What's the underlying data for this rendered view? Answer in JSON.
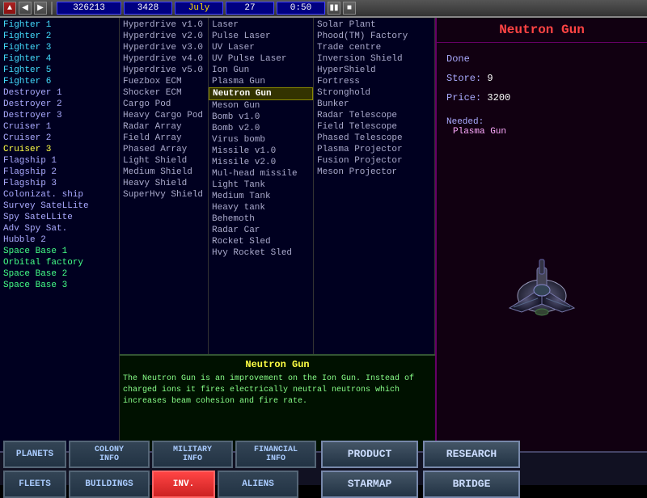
{
  "toolbar": {
    "credits": "326213",
    "production": "3428",
    "month": "July",
    "day": "27",
    "time": "0:50"
  },
  "left_list": {
    "items": [
      {
        "label": "Fighter 1",
        "style": "cyan"
      },
      {
        "label": "Fighter 2",
        "style": "cyan"
      },
      {
        "label": "Fighter 3",
        "style": "cyan"
      },
      {
        "label": "Fighter 4",
        "style": "cyan"
      },
      {
        "label": "Fighter 5",
        "style": "cyan"
      },
      {
        "label": "Fighter 6",
        "style": "cyan"
      },
      {
        "label": "Destroyer 1",
        "style": "normal"
      },
      {
        "label": "Destroyer 2",
        "style": "normal"
      },
      {
        "label": "Destroyer 3",
        "style": "normal"
      },
      {
        "label": "Cruiser 1",
        "style": "normal"
      },
      {
        "label": "Cruiser 2",
        "style": "normal"
      },
      {
        "label": "Cruiser 3",
        "style": "yellow"
      },
      {
        "label": "Flagship 1",
        "style": "normal"
      },
      {
        "label": "Flagship 2",
        "style": "normal"
      },
      {
        "label": "Flagship 3",
        "style": "normal"
      },
      {
        "label": "Colonizat. ship",
        "style": "normal"
      },
      {
        "label": "Survey SateLLite",
        "style": "normal"
      },
      {
        "label": "Spy SateLLite",
        "style": "normal"
      },
      {
        "label": "Adv Spy Sat.",
        "style": "normal"
      },
      {
        "label": "Hubble 2",
        "style": "normal"
      },
      {
        "label": "Space Base 1",
        "style": "green-text"
      },
      {
        "label": "Orbital factory",
        "style": "green-text"
      },
      {
        "label": "Space Base 2",
        "style": "green-text"
      },
      {
        "label": "Space Base 3",
        "style": "green-text"
      }
    ]
  },
  "ecm_list": {
    "items": [
      {
        "label": "Hyperdrive v1.0"
      },
      {
        "label": "Hyperdrive v2.0"
      },
      {
        "label": "Hyperdrive v3.0"
      },
      {
        "label": "Hyperdrive v4.0"
      },
      {
        "label": "Hyperdrive v5.0"
      },
      {
        "label": "Fuezbox ECM"
      },
      {
        "label": "Shocker ECM"
      },
      {
        "label": "Cargo Pod"
      },
      {
        "label": "Heavy Cargo Pod"
      },
      {
        "label": "Radar Array"
      },
      {
        "label": "Field Array"
      },
      {
        "label": "Phased Array"
      },
      {
        "label": "Light Shield"
      },
      {
        "label": "Medium Shield"
      },
      {
        "label": "Heavy Shield"
      },
      {
        "label": "SuperHvy Shield"
      }
    ]
  },
  "weapon_list": {
    "items": [
      {
        "label": "Laser"
      },
      {
        "label": "Pulse Laser"
      },
      {
        "label": "UV Laser"
      },
      {
        "label": "UV Pulse Laser"
      },
      {
        "label": "Ion Gun"
      },
      {
        "label": "Plasma Gun"
      },
      {
        "label": "Neutron Gun",
        "selected": true
      },
      {
        "label": "Meson Gun"
      },
      {
        "label": "Bomb v1.0"
      },
      {
        "label": "Bomb v2.0"
      },
      {
        "label": "Virus bomb"
      },
      {
        "label": "Missile v1.0"
      },
      {
        "label": "Missile v2.0"
      },
      {
        "label": "Mul-head missile"
      },
      {
        "label": "Light Tank"
      },
      {
        "label": "Medium Tank"
      },
      {
        "label": "Heavy tank"
      },
      {
        "label": "Behemoth"
      },
      {
        "label": "Radar Car"
      },
      {
        "label": "Rocket Sled"
      },
      {
        "label": "Hvy Rocket Sled"
      }
    ]
  },
  "building_list": {
    "items": [
      {
        "label": "Solar Plant"
      },
      {
        "label": "Phood(TM) Factory"
      },
      {
        "label": "Trade centre"
      },
      {
        "label": "Inversion Shield"
      },
      {
        "label": "HyperShield"
      },
      {
        "label": "Fortress"
      },
      {
        "label": "Stronghold"
      },
      {
        "label": "Bunker"
      },
      {
        "label": "Radar Telescope"
      },
      {
        "label": "Field Telescope"
      },
      {
        "label": "Phased Telescope"
      },
      {
        "label": "Plasma Projector"
      },
      {
        "label": "Fusion Projector"
      },
      {
        "label": "Meson Projector"
      }
    ]
  },
  "right_panel": {
    "title": "Neutron Gun",
    "done_label": "Done",
    "store_label": "Store:",
    "store_value": "9",
    "price_label": "Price:",
    "price_value": "3200",
    "needed_label": "Needed:",
    "needed_value": "Plasma Gun"
  },
  "description": {
    "title": "Neutron Gun",
    "text": "The Neutron Gun is an improvement on the Ion Gun. Instead of charged ions it fires electrically neutral neutrons which increases beam cohesion and fire rate."
  },
  "bottom_buttons": {
    "row1": [
      {
        "label": "PLANETS",
        "active": false
      },
      {
        "label": "COLONY\nINFO",
        "active": false
      },
      {
        "label": "MILITARY\nINFO",
        "active": false
      },
      {
        "label": "FINANCIAL\nINFO",
        "active": false
      },
      {
        "label": "PRODUCT",
        "large": true
      },
      {
        "label": "RESEARCH",
        "large": true
      }
    ],
    "row2": [
      {
        "label": "FLEETS",
        "active": false
      },
      {
        "label": "BUILDINGS",
        "active": false
      },
      {
        "label": "INV.",
        "active": true
      },
      {
        "label": "ALIENS",
        "active": false
      },
      {
        "label": "STARMAP",
        "large": true
      },
      {
        "label": "BRIDGE",
        "large": true
      }
    ]
  }
}
